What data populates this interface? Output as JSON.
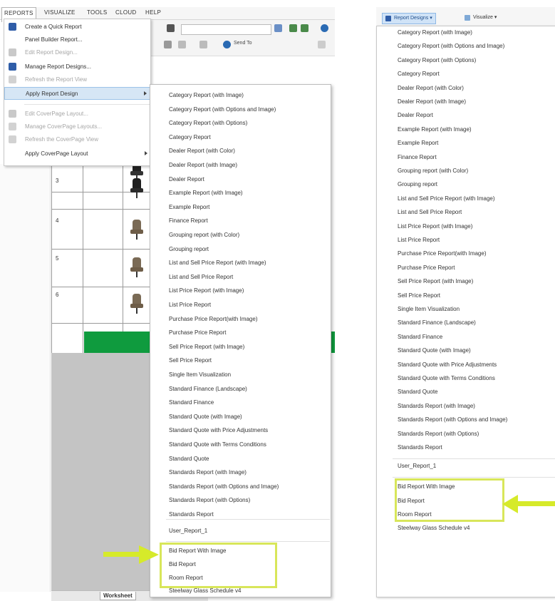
{
  "menubar": {
    "items": [
      "REPORTS",
      "VISUALIZE",
      "TOOLS",
      "CLOUD",
      "HELP"
    ]
  },
  "reports_menu": {
    "items": [
      {
        "label": "Create a Quick Report",
        "state": "enabled",
        "icon": "quick-report-icon"
      },
      {
        "label": "Panel Builder Report...",
        "state": "enabled",
        "icon": ""
      },
      {
        "label": "Edit Report Design...",
        "state": "disabled",
        "icon": "edit-report-icon"
      },
      {
        "label": "Manage Report Designs...",
        "state": "enabled",
        "icon": "manage-report-icon"
      },
      {
        "label": "Refresh the Report View",
        "state": "disabled",
        "icon": "refresh-report-icon"
      },
      {
        "label": "Apply Report Design",
        "state": "highlighted",
        "icon": ""
      },
      {
        "label": "Edit CoverPage Layout...",
        "state": "disabled",
        "icon": "edit-coverpage-icon"
      },
      {
        "label": "Manage CoverPage Layouts...",
        "state": "disabled",
        "icon": "manage-coverpage-icon"
      },
      {
        "label": "Refresh the CoverPage View",
        "state": "disabled",
        "icon": "refresh-coverpage-icon"
      },
      {
        "label": "Apply CoverPage Layout",
        "state": "enabled",
        "icon": ""
      }
    ]
  },
  "toolbar": {
    "send_to": "Send To"
  },
  "grid": {
    "row_numbers": [
      "3",
      "4",
      "5",
      "6"
    ]
  },
  "report_designs": [
    "Category Report (with Image)",
    "Category Report (with Options and Image)",
    "Category Report (with Options)",
    "Category Report",
    "Dealer Report (with Color)",
    "Dealer Report (with Image)",
    "Dealer Report",
    "Example Report (with Image)",
    "Example Report",
    "Finance Report",
    "Grouping report (with Color)",
    "Grouping report",
    "List and Sell Price Report (with Image)",
    "List and Sell Price Report",
    "List Price Report (with Image)",
    "List Price Report",
    "Purchase Price Report(with Image)",
    "Purchase Price Report",
    "Sell Price Report (with Image)",
    "Sell Price Report",
    "Single Item Visualization",
    "Standard Finance (Landscape)",
    "Standard Finance",
    "Standard Quote (with Image)",
    "Standard Quote with Price Adjustments",
    "Standard Quote with Terms  Conditions",
    "Standard Quote",
    "Standards Report (with Image)",
    "Standards Report (with Options and Image)",
    "Standards Report (with Options)",
    "Standards Report"
  ],
  "user_report": "User_Report_1",
  "highlighted_reports": [
    "Bid Report With Image",
    "Bid Report",
    "Room Report"
  ],
  "last_item": "Steelway Glass Schedule v4",
  "sheet_tab": "Worksheet",
  "right_toolbar": {
    "report_designs_button": "Report Designs",
    "visualize_button": "Visualize"
  },
  "colors": {
    "highlight_box": "#d8e65a",
    "arrow": "#d6ea2a",
    "grid_green": "#0f9b3e",
    "menu_highlight": "#d6e6f5"
  }
}
